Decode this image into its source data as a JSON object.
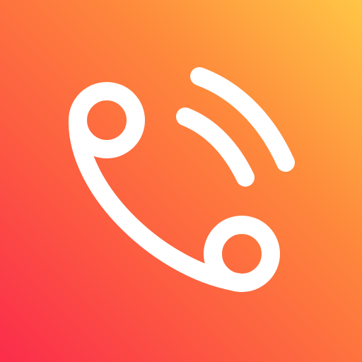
{
  "icon": {
    "name": "phone-call-icon",
    "gradient": {
      "colors": [
        "#fb2c4b",
        "#fd5b41",
        "#fe8a3c",
        "#ffc645"
      ]
    },
    "glyph_color": "#ffffff"
  }
}
